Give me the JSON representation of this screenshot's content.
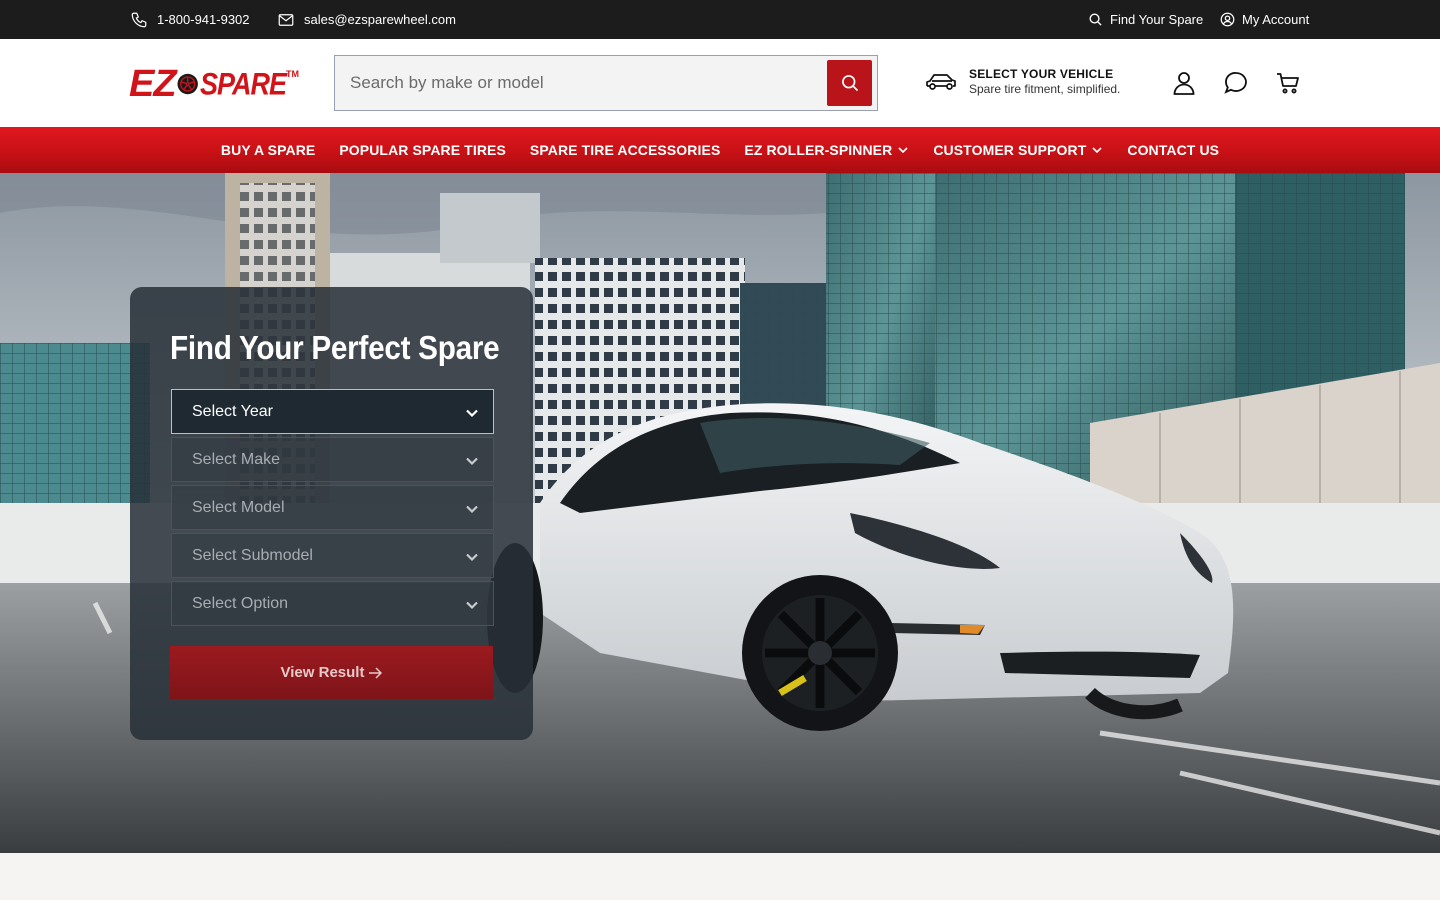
{
  "topbar": {
    "phone": "1-800-941-9302",
    "email": "sales@ezsparewheel.com",
    "find_label": "Find Your Spare",
    "account_label": "My Account",
    "icons": [
      "phone-icon",
      "mail-icon",
      "search-icon",
      "user-circle-icon"
    ]
  },
  "logo": {
    "left": "EZ",
    "right": "SPARE",
    "tm": "TM"
  },
  "search": {
    "placeholder": "Search by make or model"
  },
  "vehicle": {
    "title": "SELECT YOUR VEHICLE",
    "subtitle": "Spare tire fitment, simplified."
  },
  "nav": {
    "items": [
      {
        "label": "BUY A SPARE"
      },
      {
        "label": "POPULAR SPARE TIRES"
      },
      {
        "label": "SPARE TIRE ACCESSORIES"
      },
      {
        "label": "EZ ROLLER-SPINNER"
      },
      {
        "label": "CUSTOMER SUPPORT"
      },
      {
        "label": "CONTACT US"
      }
    ]
  },
  "finder": {
    "title": "Find Your Perfect Spare",
    "selects": [
      "Select Year",
      "Select Make",
      "Select Model",
      "Select Submodel",
      "Select Option"
    ],
    "button": "View Result"
  },
  "colors": {
    "brand_red": "#d0141a",
    "topbar": "#1c1c1c",
    "panel": "#283038"
  }
}
